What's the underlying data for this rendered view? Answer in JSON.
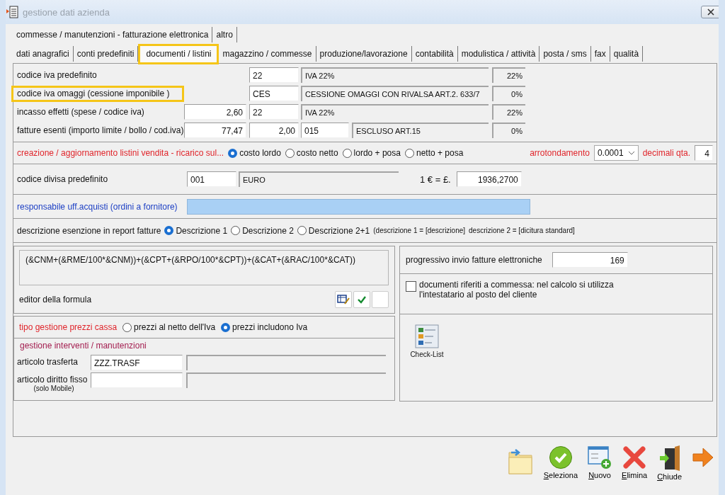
{
  "window": {
    "title": "gestione dati azienda"
  },
  "tabs_row_1": [
    {
      "label": "commesse / manutenzioni - fatturazione elettronica",
      "selected": false
    },
    {
      "label": "altro",
      "selected": false
    }
  ],
  "tabs_row_2": [
    {
      "label": "dati anagrafici",
      "selected": false,
      "highlighted": false
    },
    {
      "label": "conti predefiniti",
      "selected": false,
      "highlighted": false
    },
    {
      "label": "documenti / listini",
      "selected": true,
      "highlighted": true
    },
    {
      "label": "magazzino / commesse",
      "selected": false,
      "highlighted": false
    },
    {
      "label": "produzione/lavorazione",
      "selected": false,
      "highlighted": false
    },
    {
      "label": "contabilità",
      "selected": false,
      "highlighted": false
    },
    {
      "label": "modulistica / attività",
      "selected": false,
      "highlighted": false
    },
    {
      "label": "posta / sms",
      "selected": false,
      "highlighted": false
    },
    {
      "label": "fax",
      "selected": false,
      "highlighted": false
    },
    {
      "label": "qualità",
      "selected": false,
      "highlighted": false
    }
  ],
  "iva_rows": [
    {
      "label": "codice iva predefinito",
      "highlighted": false,
      "code": "22",
      "description": "IVA 22%",
      "percent": "22%"
    },
    {
      "label": "codice iva omaggi (cessione imponibile )",
      "highlighted": true,
      "code": "CES",
      "description": "CESSIONE OMAGGI CON RIVALSA ART.2. 633/7",
      "percent": "0%"
    },
    {
      "label": "incasso effetti (spese / codice iva)",
      "highlighted": false,
      "amount": "2,60",
      "code": "22",
      "description": "IVA 22%",
      "percent": "22%"
    },
    {
      "label": "fatture esenti (importo limite / bollo / cod.iva)",
      "highlighted": false,
      "amount": "77,47",
      "stamp": "2,00",
      "code": "015",
      "description": "ESCLUSO ART.15",
      "percent": "0%"
    }
  ],
  "listini": {
    "label": "creazione / aggiornamento listini vendita - ricarico sul...",
    "options": [
      {
        "label": "costo lordo",
        "selected": true
      },
      {
        "label": "costo netto",
        "selected": false
      },
      {
        "label": "lordo + posa",
        "selected": false
      },
      {
        "label": "netto + posa",
        "selected": false
      }
    ],
    "rounding_label": "arrotondamento",
    "rounding_value": "0.0001",
    "decimals_label": "decimali qta.",
    "decimals_value": "4"
  },
  "currency": {
    "label": "codice divisa predefinito",
    "code": "001",
    "name": "EURO",
    "rate_label": "1 € = £.",
    "rate": "1936,2700"
  },
  "buyer": {
    "label": "responsabile uff.acquisti (ordini a fornitore)"
  },
  "exemption": {
    "label": "descrizione esenzione in report fatture",
    "options": [
      {
        "label": "Descrizione 1",
        "selected": true
      },
      {
        "label": "Descrizione 2",
        "selected": false
      },
      {
        "label": "Descrizione 2+1",
        "selected": false
      }
    ],
    "note_1": "(descrizione 1 = [descrizione]",
    "note_2": "descrizione 2 = [dicitura standard]"
  },
  "formula": {
    "text": "(&CNM+(&RME/100*&CNM))+(&CPT+(&RPO/100*&CPT))+(&CAT+(&RAC/100*&CAT))",
    "editor_label": "editor della formula"
  },
  "cash_prices": {
    "label": "tipo gestione prezzi cassa",
    "options": [
      {
        "label": "prezzi al netto dell'Iva",
        "selected": false
      },
      {
        "label": "prezzi includono Iva",
        "selected": true
      }
    ]
  },
  "interventions": {
    "title": "gestione interventi / manutenzioni",
    "rows": [
      {
        "label": "articolo trasferta",
        "value": "ZZZ.TRASF"
      },
      {
        "label": "articolo diritto fisso",
        "note": "(solo Mobile)"
      }
    ]
  },
  "e_invoice": {
    "label": "progressivo invio fatture elettroniche",
    "value": "169"
  },
  "commessa_option": {
    "checked": false,
    "label": "documenti riferiti a commessa: nel calcolo si utilizza l'intestatario al posto del cliente"
  },
  "checklist": {
    "label": "Check-List"
  },
  "toolbar": [
    {
      "kind": "folder"
    },
    {
      "kind": "select",
      "label": "Seleziona"
    },
    {
      "kind": "new",
      "label": "Nuovo"
    },
    {
      "kind": "delete",
      "label": "Elimina"
    },
    {
      "kind": "exit",
      "label": "Chiude"
    },
    {
      "kind": "next"
    }
  ]
}
